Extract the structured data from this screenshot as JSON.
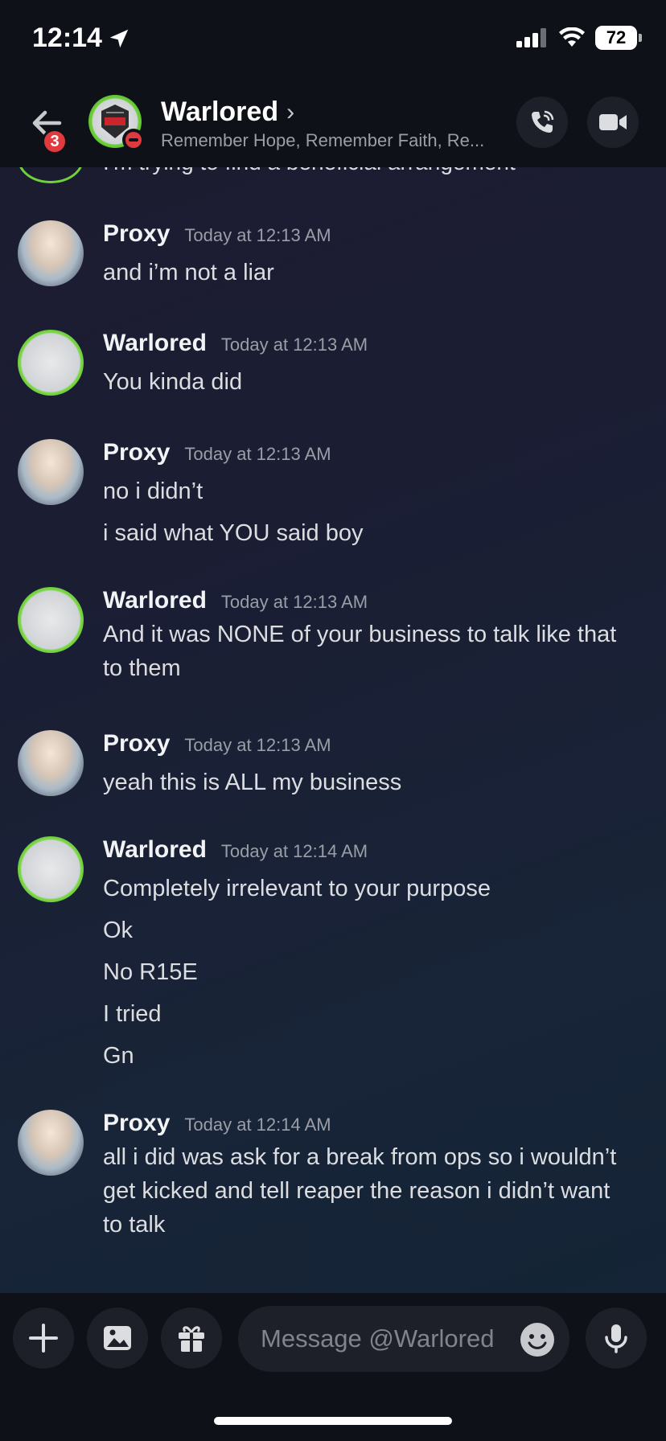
{
  "status_bar": {
    "time": "12:14",
    "battery": "72"
  },
  "header": {
    "back_badge": "3",
    "name": "Warlored",
    "name_chevron": "›",
    "subtitle": "Remember Hope, Remember Faith, Re..."
  },
  "chat": {
    "partial_top_line": "I'm trying to find a beneficial arrangement",
    "messages": [
      {
        "author": "Proxy",
        "time": "Today at 12:13 AM",
        "lines": [
          "and i’m not a liar"
        ]
      },
      {
        "author": "Warlored",
        "time": "Today at 12:13 AM",
        "lines": [
          "You kinda did"
        ]
      },
      {
        "author": "Proxy",
        "time": "Today at 12:13 AM",
        "lines": [
          "no i didn’t",
          "i said what YOU said boy"
        ]
      },
      {
        "author": "Warlored",
        "time": "Today at 12:13 AM",
        "lines": [
          "And it was NONE of your business to talk like that",
          "to them"
        ]
      },
      {
        "author": "Proxy",
        "time": "Today at 12:13 AM",
        "lines": [
          "yeah this is ALL my business"
        ]
      },
      {
        "author": "Warlored",
        "time": "Today at 12:14 AM",
        "lines": [
          "Completely irrelevant to your purpose",
          "Ok",
          "No R15E",
          "I tried",
          "Gn"
        ]
      },
      {
        "author": "Proxy",
        "time": "Today at 12:14 AM",
        "lines": [
          "all i did was ask for a break from ops so i wouldn’t",
          "get kicked and tell reaper the reason i didn’t want",
          "to talk"
        ]
      }
    ]
  },
  "composer": {
    "placeholder": "Message @Warlored"
  },
  "colors": {
    "accent_green": "#6fd23a",
    "badge_red": "#e0393e",
    "bar": "#0e1117"
  },
  "icons": [
    "back-arrow-icon",
    "phone-call-icon",
    "video-camera-icon",
    "plus-icon",
    "image-icon",
    "gift-icon",
    "emoji-icon",
    "microphone-icon",
    "location-arrow-icon",
    "signal-icon",
    "wifi-icon"
  ]
}
